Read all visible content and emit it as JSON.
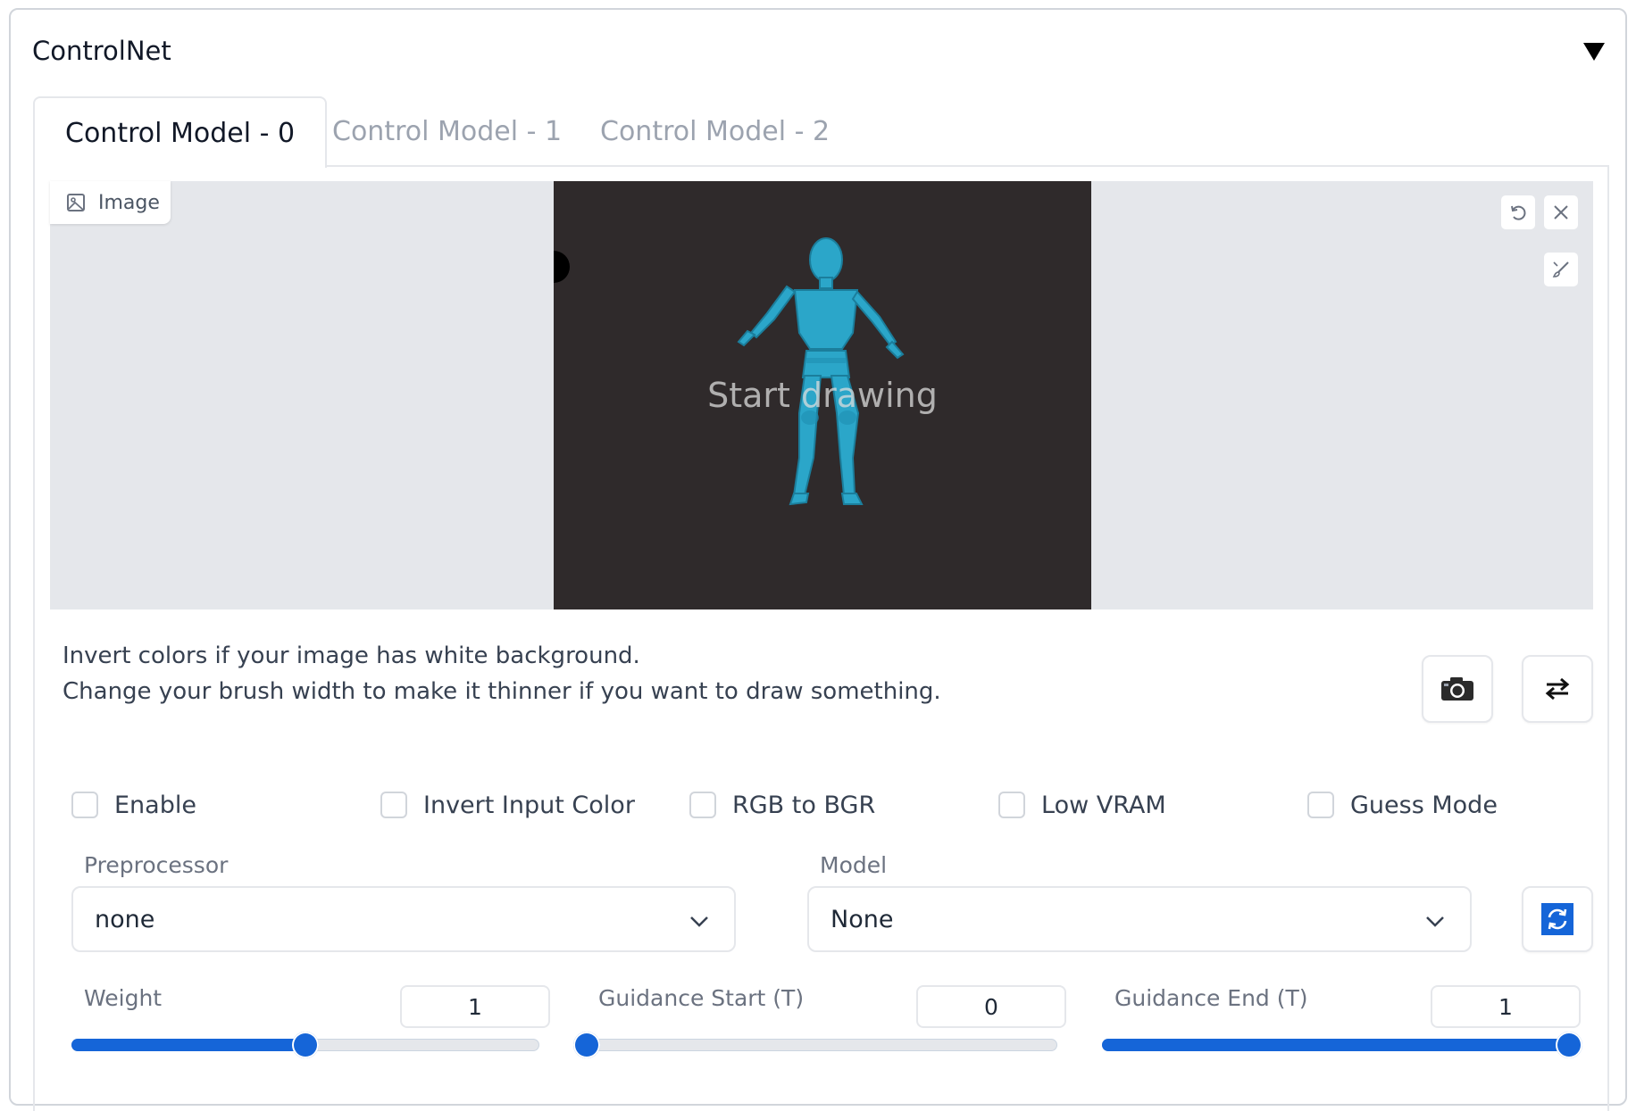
{
  "panel": {
    "title": "ControlNet"
  },
  "tabs": [
    {
      "label": "Control Model - 0",
      "active": true
    },
    {
      "label": "Control Model - 1",
      "active": false
    },
    {
      "label": "Control Model - 2",
      "active": false
    }
  ],
  "image_input": {
    "label": "Image",
    "placeholder": "Start drawing",
    "tools": [
      "undo-icon",
      "close-icon",
      "brush-icon"
    ]
  },
  "info": {
    "line1": "Invert colors if your image has white background.",
    "line2": "Change your brush width to make it thinner if you want to draw something."
  },
  "action_icons": [
    "camera-icon",
    "swap-arrows-icon",
    "refresh-icon"
  ],
  "checkboxes": [
    {
      "label": "Enable",
      "checked": false
    },
    {
      "label": "Invert Input Color",
      "checked": false
    },
    {
      "label": "RGB to BGR",
      "checked": false
    },
    {
      "label": "Low VRAM",
      "checked": false
    },
    {
      "label": "Guess Mode",
      "checked": false
    }
  ],
  "preprocessor": {
    "label": "Preprocessor",
    "value": "none"
  },
  "model": {
    "label": "Model",
    "value": "None"
  },
  "sliders": {
    "weight": {
      "label": "Weight",
      "value": "1",
      "level": 0.5
    },
    "guidance_start": {
      "label": "Guidance Start (T)",
      "value": "0",
      "level": 0.0
    },
    "guidance_end": {
      "label": "Guidance End (T)",
      "value": "1",
      "level": 1.0
    }
  },
  "colors": {
    "accent": "#1565d8",
    "canvas_bg": "#2f2a2b",
    "figure": "#2ba6c9"
  }
}
